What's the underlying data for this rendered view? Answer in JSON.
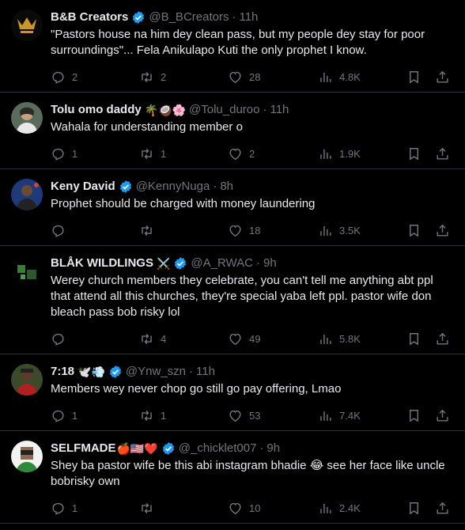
{
  "colors": {
    "background": "#000000",
    "text": "#e7e9ea",
    "muted": "#71767b",
    "verified": "#1d9bf0",
    "divider": "#2f3336"
  },
  "tweets": [
    {
      "name": "B&B Creators",
      "emoji": "",
      "verified": true,
      "handle": "@B_BCreators",
      "dot": "·",
      "time": "11h",
      "text": "\"Pastors house na him dey clean pass, but my people dey stay for poor surroundings\"... Fela Anikulapo Kuti the only prophet I know.",
      "replies": "2",
      "retweets": "2",
      "likes": "28",
      "views": "4.8K"
    },
    {
      "name": "Tolu omo daddy",
      "emoji": "🌴🥥🌸",
      "verified": false,
      "handle": "@Tolu_duroo",
      "dot": "·",
      "time": "11h",
      "text": "Wahala for understanding member o",
      "replies": "1",
      "retweets": "1",
      "likes": "2",
      "views": "1.9K"
    },
    {
      "name": "Keny David",
      "emoji": "",
      "verified": true,
      "handle": "@KennyNuga",
      "dot": "·",
      "time": "8h",
      "text": "Prophet should be charged with money laundering",
      "replies": "",
      "retweets": "",
      "likes": "18",
      "views": "3.5K"
    },
    {
      "name": "BLÅK WILDLINGS",
      "emoji": "⚔️",
      "verified": true,
      "handle": "@A_RWAC",
      "dot": "·",
      "time": "9h",
      "text": "Werey church members they celebrate, you can't tell me anything abt ppl that attend all this churches, they're special yaba left ppl. pastor wife don bleach pass bob risky lol",
      "replies": "",
      "retweets": "4",
      "likes": "49",
      "views": "5.8K"
    },
    {
      "name": "7:18",
      "emoji": "🕊️💨",
      "verified": true,
      "handle": "@Ynw_szn",
      "dot": "·",
      "time": "11h",
      "text": "Members wey never chop go still go pay offering, Lmao",
      "replies": "1",
      "retweets": "1",
      "likes": "53",
      "views": "7.4K"
    },
    {
      "name": "SELFMADE",
      "emoji": "🍎🇺🇸❤️",
      "verified": true,
      "handle": "@_chicklet007",
      "dot": "·",
      "time": "9h",
      "text": "Shey ba pastor wife be this abi instagram bhadie 😂 see her face like uncle bobrisky own",
      "replies": "1",
      "retweets": "",
      "likes": "10",
      "views": "2.4K"
    }
  ]
}
